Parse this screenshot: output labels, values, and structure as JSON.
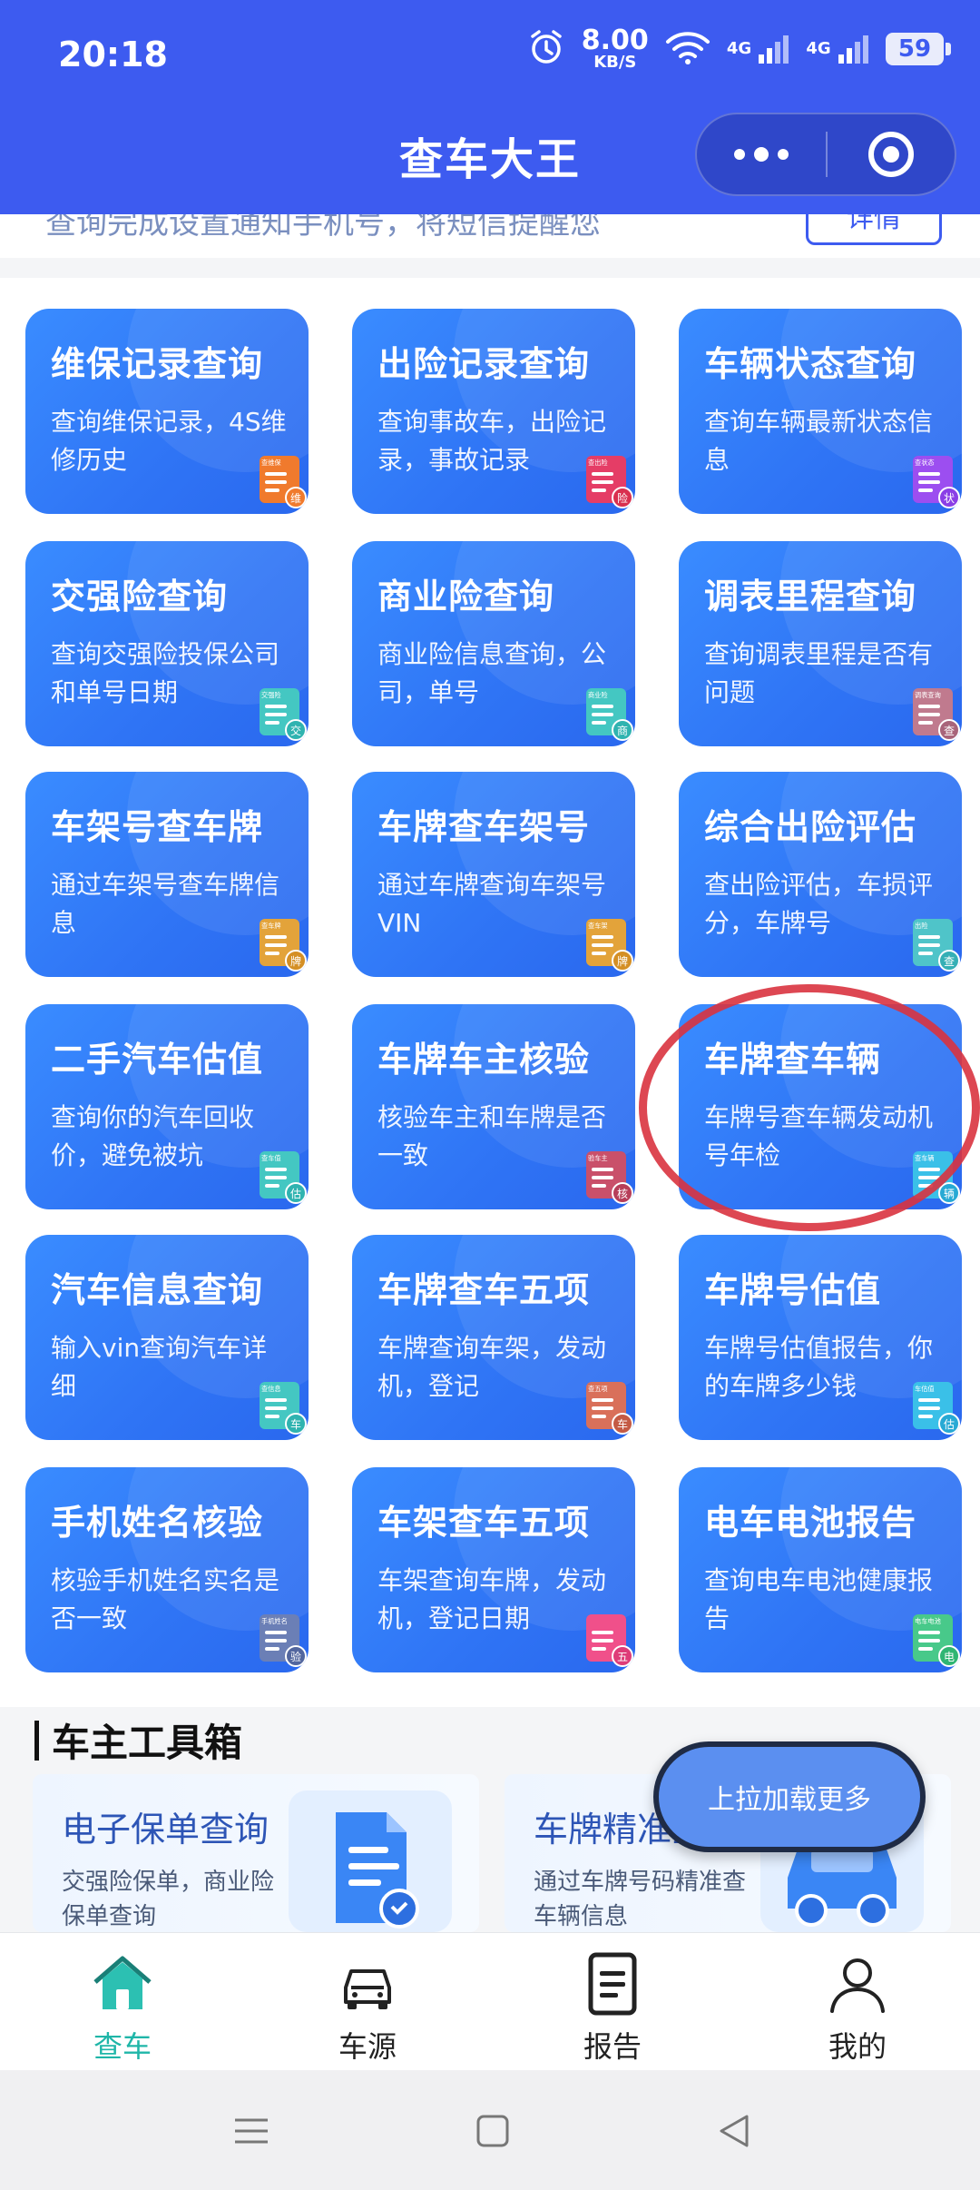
{
  "status_bar": {
    "time": "20:18",
    "speed_value": "8.00",
    "speed_unit": "KB/S",
    "net1": "4G",
    "net2": "4G",
    "battery": "59",
    "icons": [
      "alarm-icon",
      "wifi-icon",
      "signal-icon",
      "signal-icon",
      "battery-icon"
    ]
  },
  "header": {
    "title": "查车大王",
    "more_icon": "more-dots-icon",
    "close_icon": "target-circle-icon"
  },
  "banner": {
    "text": "查询完成设置通知手机号，将短信提醒您",
    "button": "详情"
  },
  "services": [
    {
      "title": "维保记录查询",
      "desc": "查询维保记录，4S维修历史",
      "icon_label": "查维保",
      "badge": "维",
      "icon_color": "#f07a2d",
      "badge_color": "#f07a2d"
    },
    {
      "title": "出险记录查询",
      "desc": "查询事故车，出险记录，事故记录",
      "icon_label": "查出险",
      "badge": "险",
      "icon_color": "#e53d66",
      "badge_color": "#d9304f"
    },
    {
      "title": "车辆状态查询",
      "desc": "查询车辆最新状态信息",
      "icon_label": "查状态",
      "badge": "状",
      "icon_color": "#9c4ef0",
      "badge_color": "#8a3ee6"
    },
    {
      "title": "交强险查询",
      "desc": "查询交强险投保公司和单号日期",
      "icon_label": "交强险",
      "badge": "交",
      "icon_color": "#44c7c2",
      "badge_color": "#2fb3b0"
    },
    {
      "title": "商业险查询",
      "desc": "商业险信息查询，公司，单号",
      "icon_label": "商业险",
      "badge": "商",
      "icon_color": "#44c7c2",
      "badge_color": "#2fb3b0"
    },
    {
      "title": "调表里程查询",
      "desc": "查询调表里程是否有问题",
      "icon_label": "调表查询",
      "badge": "查",
      "icon_color": "#c07a8e",
      "badge_color": "#a8647a"
    },
    {
      "title": "车架号查车牌",
      "desc": "通过车架号查车牌信息",
      "icon_label": "查车牌",
      "badge": "牌",
      "icon_color": "#e3a33a",
      "badge_color": "#d48f25"
    },
    {
      "title": "车牌查车架号",
      "desc": "通过车牌查询车架号VIN",
      "icon_label": "查车架",
      "badge": "牌",
      "icon_color": "#e3a33a",
      "badge_color": "#d48f25"
    },
    {
      "title": "综合出险评估",
      "desc": "查出险评估，车损评分，车牌号",
      "icon_label": "出险",
      "badge": "查",
      "icon_color": "#4fc4c9",
      "badge_color": "#35afb5"
    },
    {
      "title": "二手汽车估值",
      "desc": "查询你的汽车回收价，避免被坑",
      "icon_label": "查车值",
      "badge": "估",
      "icon_color": "#44c7c2",
      "badge_color": "#2fb3b0"
    },
    {
      "title": "车牌车主核验",
      "desc": "核验车主和车牌是否一致",
      "icon_label": "验车主",
      "badge": "核",
      "icon_color": "#c9506a",
      "badge_color": "#b73e59"
    },
    {
      "title": "车牌查车辆",
      "desc": "车牌号查车辆发动机号年检",
      "icon_label": "查车辆",
      "badge": "辆",
      "icon_color": "#3ac0e8",
      "badge_color": "#27a9d4"
    },
    {
      "title": "汽车信息查询",
      "desc": "输入vin查询汽车详细",
      "icon_label": "查信息",
      "badge": "车",
      "icon_color": "#44c7c2",
      "badge_color": "#2fb3b0"
    },
    {
      "title": "车牌查车五项",
      "desc": "车牌查询车架，发动机，登记",
      "icon_label": "查五项",
      "badge": "车",
      "icon_color": "#d9705a",
      "badge_color": "#c45a44"
    },
    {
      "title": "车牌号估值",
      "desc": "车牌号估值报告，你的车牌多少钱",
      "icon_label": "车估值",
      "badge": "估",
      "icon_color": "#3ac0e8",
      "badge_color": "#27a9d4"
    },
    {
      "title": "手机姓名核验",
      "desc": "核验手机姓名实名是否一致",
      "icon_label": "手机姓名",
      "badge": "验",
      "icon_color": "#6b7fb6",
      "badge_color": "#52669e"
    },
    {
      "title": "车架查车五项",
      "desc": "车架查询车牌，发动机，登记日期",
      "icon_label": "",
      "badge": "五",
      "icon_color": "#f0508a",
      "badge_color": "#de3c78"
    },
    {
      "title": "电车电池报告",
      "desc": "查询电车电池健康报告",
      "icon_label": "电车电池",
      "badge": "电",
      "icon_color": "#48c98a",
      "badge_color": "#30b573"
    }
  ],
  "toolbox": {
    "title": "车主工具箱",
    "items": [
      {
        "title": "电子保单查询",
        "desc": "交强险保单，商业险保单查询"
      },
      {
        "title": "车牌精准查",
        "desc": "通过车牌号码精准查车辆信息"
      }
    ]
  },
  "load_more": "上拉加载更多",
  "tabs": [
    {
      "label": "查车",
      "icon": "home-icon",
      "active": true
    },
    {
      "label": "车源",
      "icon": "car-icon",
      "active": false
    },
    {
      "label": "报告",
      "icon": "report-icon",
      "active": false
    },
    {
      "label": "我的",
      "icon": "user-icon",
      "active": false
    }
  ],
  "colors": {
    "header_bg": "#3d5bf0",
    "card_blue": "#2f74f5",
    "active_tab": "#1fb6a8",
    "highlight_circle": "#d9333f"
  }
}
